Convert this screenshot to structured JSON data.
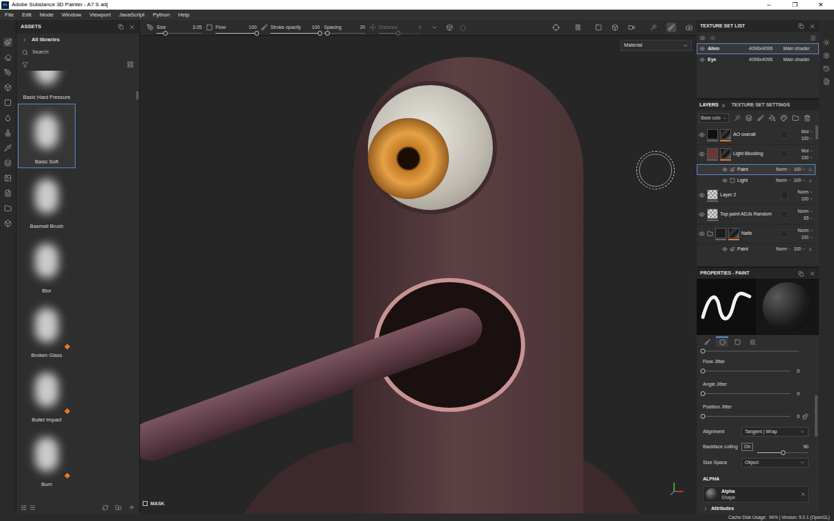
{
  "window": {
    "title": "Adobe Substance 3D Painter - A7 S adj",
    "app_icon": "Pt",
    "controls": [
      "–",
      "❐",
      "✕"
    ]
  },
  "menu": [
    "File",
    "Edit",
    "Mode",
    "Window",
    "Viewport",
    "JavaScript",
    "Python",
    "Help"
  ],
  "assets": {
    "title": "ASSETS",
    "library": "All libraries",
    "search": {
      "placeholder": "Search"
    },
    "items": [
      {
        "label": "Basic Hard Pressure",
        "selected": false,
        "badge": false
      },
      {
        "label": "Basic Soft",
        "selected": true,
        "badge": false
      },
      {
        "label": "Basmati Brush",
        "selected": false,
        "badge": false
      },
      {
        "label": "Blur",
        "selected": false,
        "badge": false
      },
      {
        "label": "Broken Glass",
        "selected": false,
        "badge": true
      },
      {
        "label": "Bullet Impact",
        "selected": false,
        "badge": true
      },
      {
        "label": "Burn",
        "selected": false,
        "badge": true
      }
    ]
  },
  "tool_options": [
    {
      "label": "Size",
      "value": "3.05",
      "level": 0.2,
      "disabled": false
    },
    {
      "label": "Flow",
      "value": "100",
      "level": 1,
      "disabled": false
    },
    {
      "label": "Stroke opacity",
      "value": "100",
      "level": 1,
      "disabled": false
    },
    {
      "label": "Spacing",
      "value": "20",
      "level": 0.08,
      "disabled": false
    },
    {
      "label": "Distance",
      "value": "5",
      "level": 0.45,
      "disabled": true
    }
  ],
  "viewport": {
    "mode": "Material",
    "mask": {
      "label": "MASK",
      "checked": false
    }
  },
  "texture_sets": {
    "title": "TEXTURE SET LIST",
    "items": [
      {
        "name": "Alien",
        "resolution": "4096x4096",
        "shader": "Main shader",
        "selected": true,
        "visible": true
      },
      {
        "name": "Eye",
        "resolution": "4096x4096",
        "shader": "Main shader",
        "selected": false,
        "visible": true
      }
    ]
  },
  "layers": {
    "tabs": [
      {
        "label": "LAYERS",
        "selected": true
      },
      {
        "label": "TEXTURE SET SETTINGS",
        "selected": false
      }
    ],
    "channel": "Base colo",
    "items": [
      {
        "name": "AO overall",
        "kind": "layer",
        "blend": "Mul",
        "opacity": "100",
        "visible": true,
        "selected": false,
        "thumbnail": "solid",
        "color": "#101010",
        "mask": true
      },
      {
        "name": "Light Blocking",
        "kind": "layer",
        "blend": "Mul",
        "opacity": "100",
        "visible": true,
        "selected": false,
        "thumbnail": "solid",
        "color": "#6b3636",
        "mask": true
      },
      {
        "name": "Paint",
        "kind": "paint-effect",
        "blend": "Norm",
        "opacity": "100",
        "visible": true,
        "selected": true
      },
      {
        "name": "Light",
        "kind": "fill-effect",
        "blend": "Norm",
        "opacity": "100",
        "visible": true,
        "selected": false
      },
      {
        "name": "Layer 2",
        "kind": "layer",
        "blend": "Norm",
        "opacity": "100",
        "visible": true,
        "selected": false,
        "thumbnail": "checker",
        "color": "#d0d0d0",
        "mask": false
      },
      {
        "name": "Top paint ADJs Random",
        "kind": "layer",
        "blend": "Norm",
        "opacity": "65",
        "visible": true,
        "selected": false,
        "thumbnail": "checker",
        "color": "#d0d0d0",
        "mask": false
      },
      {
        "name": "Nails",
        "kind": "folder",
        "blend": "Norm",
        "opacity": "100",
        "visible": true,
        "selected": false,
        "thumbnail": "solid",
        "color": "#1c1c1c",
        "mask": true
      },
      {
        "name": "Paint",
        "kind": "paint-effect",
        "blend": "Norm",
        "opacity": "100",
        "visible": true,
        "selected": false
      }
    ]
  },
  "properties": {
    "title": "PROPERTIES - PAINT",
    "tabs": [
      {
        "kind": "brush",
        "selected": false
      },
      {
        "kind": "material",
        "selected": true
      },
      {
        "kind": "mask",
        "selected": false
      },
      {
        "kind": "grayscale",
        "selected": false
      }
    ],
    "top_slider_level": 0,
    "sliders": [
      {
        "label": "Flow Jitter",
        "value": "0",
        "level": 0,
        "random": false
      },
      {
        "label": "Angle Jitter",
        "value": "0",
        "level": 0,
        "random": false
      },
      {
        "label": "Position Jitter",
        "value": "0",
        "level": 0,
        "random": true
      }
    ],
    "alignment": {
      "label": "Alignment",
      "value": "Tangent | Wrap"
    },
    "backface": {
      "label": "Backface culling",
      "toggle": "On",
      "value": "90",
      "level": 0.5
    },
    "size_space": {
      "label": "Size Space",
      "value": "Object"
    },
    "alpha": {
      "header": "ALPHA",
      "name": "Alpha",
      "type": "Shape"
    },
    "attributes": {
      "label": "Attributes",
      "expanded": false
    }
  },
  "status_bar": "Cache Disk Usage:  94% | Version: 9.0.1 (OpenGL)"
}
